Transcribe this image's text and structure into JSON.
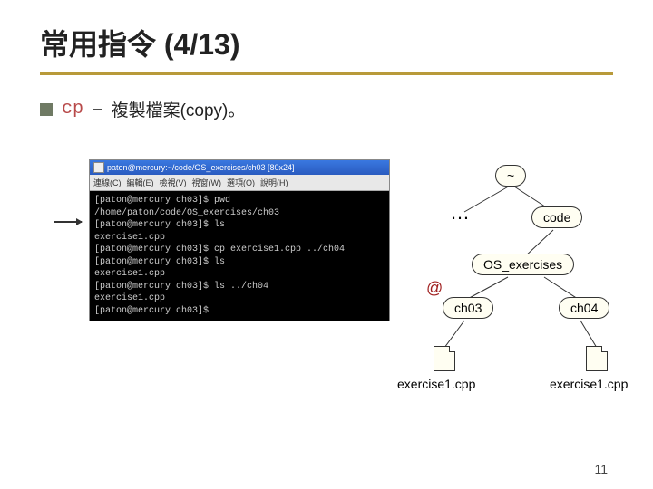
{
  "title": "常用指令 (4/13)",
  "command": "cp",
  "dash": "–",
  "description": "複製檔案(copy)。",
  "terminal": {
    "title": "paton@mercury:~/code/OS_exercises/ch03 [80x24]",
    "menus": [
      "連線(C)",
      "編輯(E)",
      "檢視(V)",
      "視窗(W)",
      "選項(O)",
      "說明(H)"
    ],
    "lines": "[paton@mercury ch03]$ pwd\n/home/paton/code/OS_exercises/ch03\n[paton@mercury ch03]$ ls\nexercise1.cpp\n[paton@mercury ch03]$ cp exercise1.cpp ../ch04\n[paton@mercury ch03]$ ls\nexercise1.cpp\n[paton@mercury ch03]$ ls ../ch04\nexercise1.cpp\n[paton@mercury ch03]$ "
  },
  "tree": {
    "root": "~",
    "dots": "…",
    "code": "code",
    "os": "OS_exercises",
    "at": "@",
    "ch03": "ch03",
    "ch04": "ch04",
    "file1": "exercise1.cpp",
    "file2": "exercise1.cpp"
  },
  "page": "11"
}
